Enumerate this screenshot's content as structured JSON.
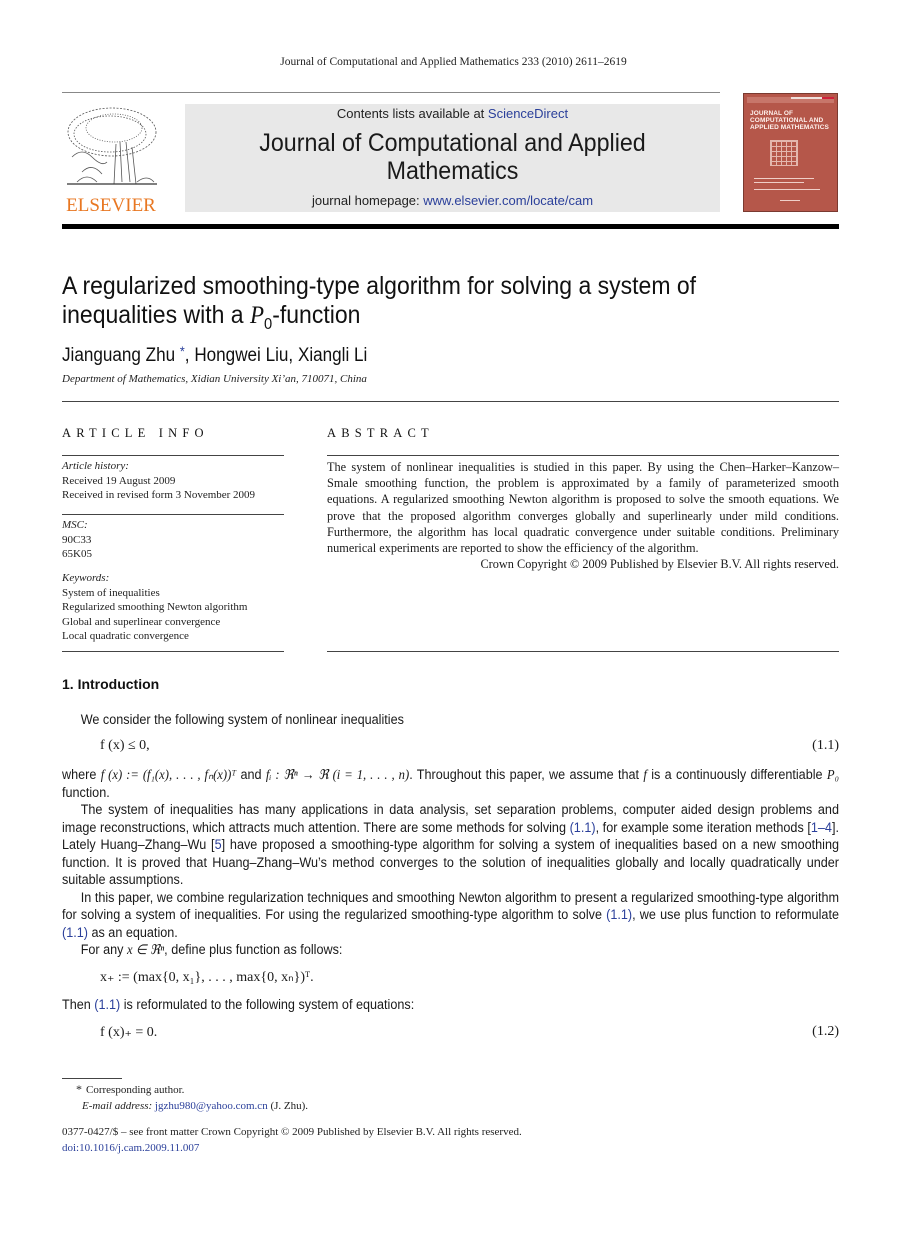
{
  "running_head": "Journal of Computational and Applied Mathematics 233 (2010) 2611–2619",
  "header": {
    "publisher_logo_text": "ELSEVIER",
    "contents_prefix": "Contents lists available at ",
    "contents_link": "ScienceDirect",
    "journal_title_line1": "Journal of Computational and Applied",
    "journal_title_line2": "Mathematics",
    "homepage_prefix": "journal homepage: ",
    "homepage_link": "www.elsevier.com/locate/cam",
    "cover_title": [
      "JOURNAL OF",
      "COMPUTATIONAL AND",
      "APPLIED MATHEMATICS"
    ],
    "brand_color": "#e87722",
    "cover_color": "#b5574a"
  },
  "article": {
    "title_line1": "A regularized smoothing-type algorithm for solving a system of",
    "title_line2_prefix": "inequalities with a ",
    "title_line2_math": "P",
    "title_line2_sub": "0",
    "title_line2_suffix": "-function",
    "authors": [
      {
        "name": "Jianguang Zhu",
        "mark": "*"
      },
      {
        "name": "Hongwei Liu"
      },
      {
        "name": "Xiangli Li"
      }
    ],
    "affiliation": "Department of Mathematics, Xidian University Xi’an, 710071, China"
  },
  "article_info": {
    "heading": "ARTICLE INFO",
    "history_label": "Article history:",
    "received": "Received 19 August 2009",
    "revised": "Received in revised form 3 November 2009",
    "msc_label": "MSC:",
    "msc": [
      "90C33",
      "65K05"
    ],
    "keywords_label": "Keywords:",
    "keywords": [
      "System of inequalities",
      "Regularized smoothing Newton algorithm",
      "Global and superlinear convergence",
      "Local quadratic convergence"
    ]
  },
  "abstract": {
    "heading": "ABSTRACT",
    "text": "The system of nonlinear inequalities is studied in this paper. By using the Chen–Harker–Kanzow–Smale smoothing function, the problem is approximated by a family of parameterized smooth equations. A regularized smoothing Newton algorithm is proposed to solve the smooth equations. We prove that the proposed algorithm converges globally and superlinearly under mild conditions. Furthermore, the algorithm has local quadratic convergence under suitable conditions. Preliminary numerical experiments are reported to show the efficiency of the algorithm.",
    "copyright": "Crown Copyright © 2009 Published by Elsevier B.V. All rights reserved."
  },
  "section1": {
    "heading": "1.  Introduction",
    "p1": "We consider the following system of nonlinear inequalities",
    "eq1": "f (x) ≤ 0,",
    "eq1_num": "(1.1)",
    "p2a": "where ",
    "p2_math1": "f (x) := (f₁(x), . . . , fₙ(x))ᵀ",
    "p2b": " and ",
    "p2_math2": "fᵢ : ℜⁿ → ℜ (i = 1, . . . , n)",
    "p2c": ". Throughout this paper, we assume that ",
    "p2_math3": "f",
    "p2d": " is a continuously differentiable ",
    "p2_math4": "P₀",
    "p2e": " function.",
    "p3a": "The system of inequalities has many applications in data analysis, set separation problems, computer aided design problems and image reconstructions, which attracts much attention. There are some methods for solving ",
    "p3_ref1": "(1.1)",
    "p3b": ", for example some iteration methods [",
    "p3_ref2": "1–4",
    "p3c": "]. Lately Huang–Zhang–Wu [",
    "p3_ref3": "5",
    "p3d": "] have proposed a smoothing-type algorithm for solving a system of inequalities based on a new smoothing function. It is proved that Huang–Zhang–Wu’s method converges to the solution of inequalities globally and locally quadratically under suitable assumptions.",
    "p4a": "In this paper, we combine regularization techniques and smoothing Newton algorithm to present a regularized smoothing-type algorithm for solving a system of inequalities. For using the regularized smoothing-type algorithm to solve ",
    "p4_ref1": "(1.1)",
    "p4b": ", we use plus function to reformulate ",
    "p4_ref2": "(1.1)",
    "p4c": " as an equation.",
    "p5a": "For any ",
    "p5_math": "x ∈ ℜⁿ",
    "p5b": ", define plus function as follows:",
    "eq_plus": "x₊ := (max{0, x₁}, . . . , max{0, xₙ})ᵀ.",
    "p6a": "Then ",
    "p6_ref": "(1.1)",
    "p6b": " is reformulated to the following system of equations:",
    "eq2": "f (x)₊ = 0.",
    "eq2_num": "(1.2)"
  },
  "footnote": {
    "mark": "*",
    "corresponding": "Corresponding author.",
    "email_label": "E-mail address: ",
    "email": "jgzhu980@yahoo.com.cn",
    "email_suffix": " (J. Zhu)."
  },
  "footer": {
    "issn_line": "0377-0427/$ – see front matter Crown Copyright © 2009 Published by Elsevier B.V. All rights reserved.",
    "doi": "doi:10.1016/j.cam.2009.11.007"
  }
}
